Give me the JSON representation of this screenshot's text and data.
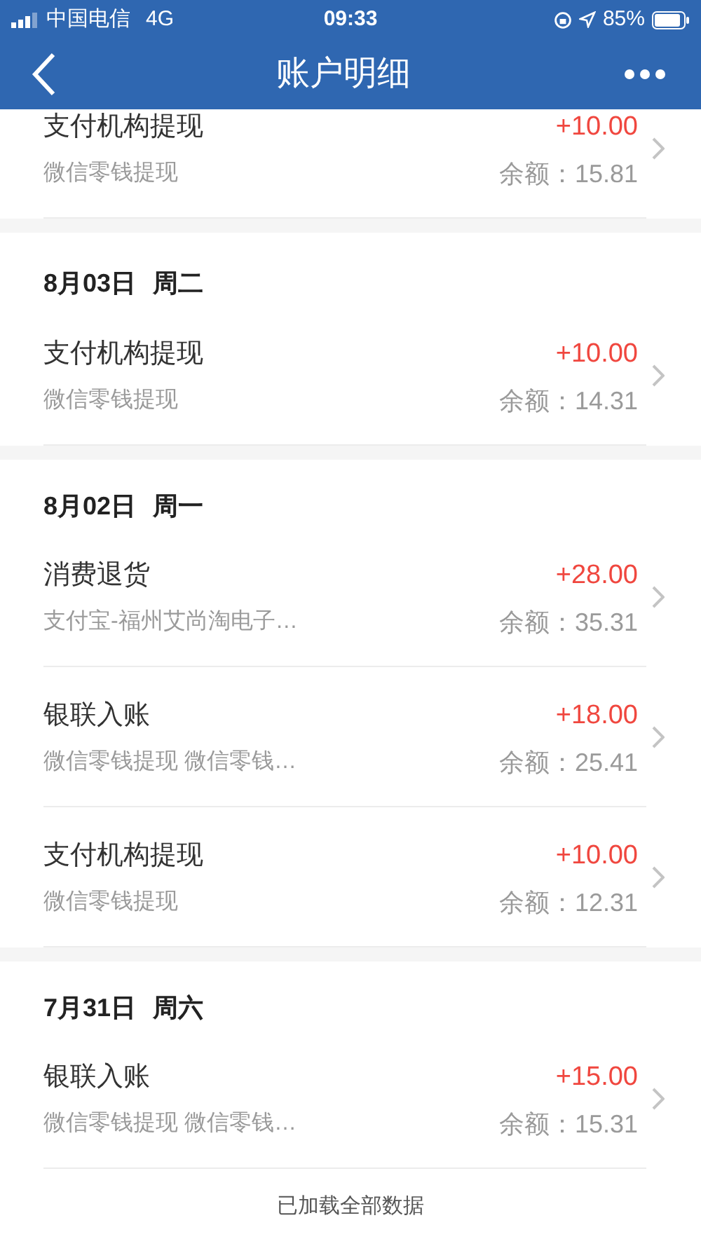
{
  "status_bar": {
    "carrier": "中国电信",
    "network": "4G",
    "time": "09:33",
    "battery": "85%"
  },
  "nav": {
    "title": "账户明细"
  },
  "groups": [
    {
      "items": [
        {
          "title": "支付机构提现",
          "subtitle": "微信零钱提现",
          "amount": "+10.00",
          "balance": "余额：15.81"
        }
      ]
    },
    {
      "date": "8月03日",
      "weekday": "周二",
      "items": [
        {
          "title": "支付机构提现",
          "subtitle": "微信零钱提现",
          "amount": "+10.00",
          "balance": "余额：14.31"
        }
      ]
    },
    {
      "date": "8月02日",
      "weekday": "周一",
      "items": [
        {
          "title": "消费退货",
          "subtitle": "支付宝-福州艾尚淘电子…",
          "amount": "+28.00",
          "balance": "余额：35.31"
        },
        {
          "title": "银联入账",
          "subtitle": "微信零钱提现 微信零钱…",
          "amount": "+18.00",
          "balance": "余额：25.41"
        },
        {
          "title": "支付机构提现",
          "subtitle": "微信零钱提现",
          "amount": "+10.00",
          "balance": "余额：12.31"
        }
      ]
    },
    {
      "date": "7月31日",
      "weekday": "周六",
      "items": [
        {
          "title": "银联入账",
          "subtitle": "微信零钱提现 微信零钱…",
          "amount": "+15.00",
          "balance": "余额：15.31"
        }
      ]
    }
  ],
  "footer": "已加载全部数据"
}
